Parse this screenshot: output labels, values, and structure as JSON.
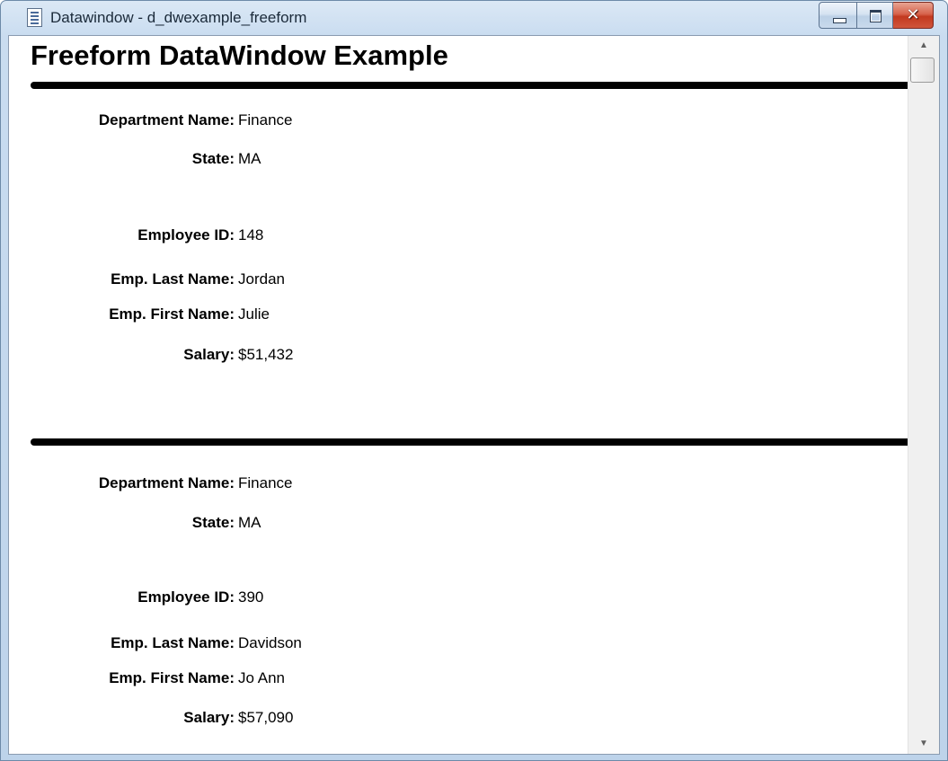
{
  "window": {
    "title": "Datawindow - d_dwexample_freeform",
    "icon": "datawindow-document-icon",
    "controls": {
      "minimize_icon": "minimize-icon",
      "maximize_icon": "maximize-icon",
      "close_icon": "close-icon",
      "close_glyph": "✕"
    }
  },
  "report": {
    "heading": "Freeform DataWindow Example",
    "labels": {
      "department": "Department Name:",
      "state": "State:",
      "employee_id": "Employee ID:",
      "last_name": "Emp. Last Name:",
      "first_name": "Emp. First Name:",
      "salary": "Salary:"
    },
    "records": [
      {
        "department": "Finance",
        "state": "MA",
        "employee_id": "148",
        "last_name": "Jordan",
        "first_name": "Julie",
        "salary": "$51,432"
      },
      {
        "department": "Finance",
        "state": "MA",
        "employee_id": "390",
        "last_name": "Davidson",
        "first_name": "Jo Ann",
        "salary": "$57,090"
      }
    ]
  },
  "scrollbar": {
    "up_arrow": "▲",
    "down_arrow": "▼"
  },
  "colors": {
    "title_bar": "#c9dcf0",
    "close_button": "#c2391f",
    "rule": "#000000",
    "background": "#ffffff"
  }
}
